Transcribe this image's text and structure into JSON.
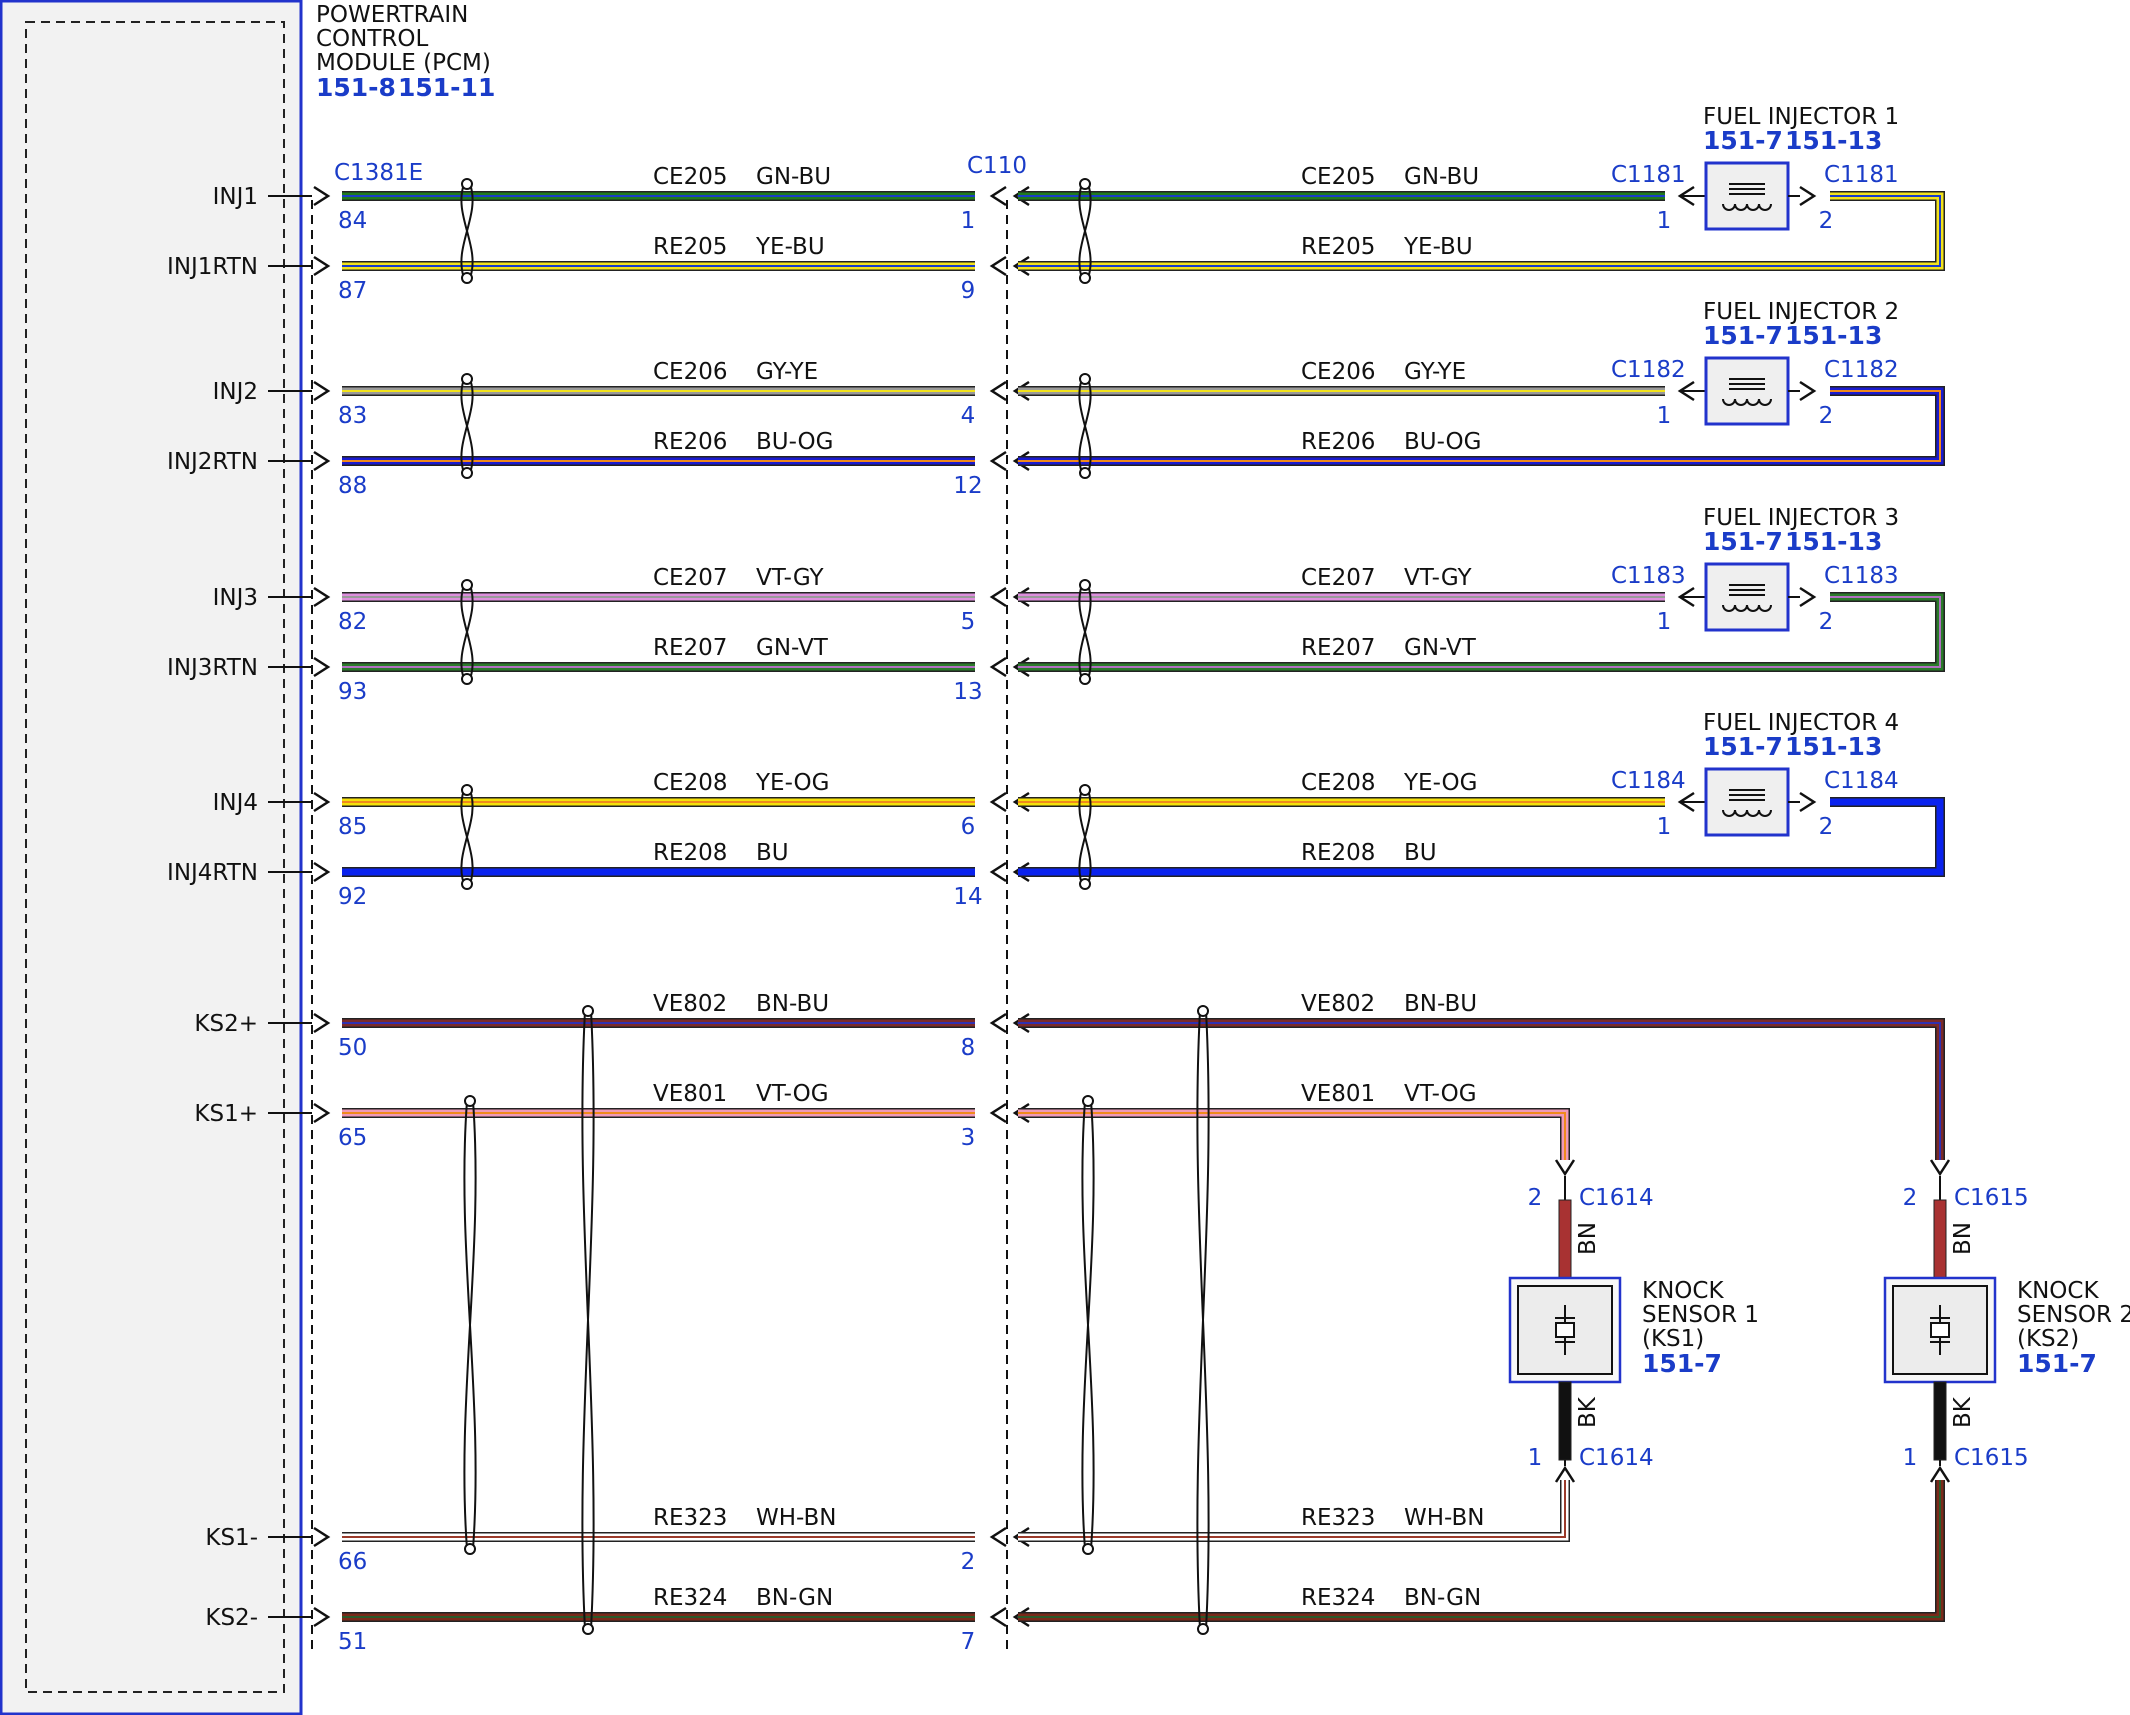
{
  "pcm": {
    "title_lines": [
      "POWERTRAIN",
      "CONTROL",
      "MODULE (PCM)"
    ],
    "refs": [
      "151-8",
      "151-11"
    ],
    "connector": "C1381E"
  },
  "inline_connector": "C110",
  "circuits": [
    {
      "signal": "INJ1",
      "circuit": "CE205",
      "color_code": "GN-BU",
      "pcm_pin": "84",
      "c110_pin": "1",
      "colors": [
        "#1f7a1f",
        "#1a3cc8"
      ]
    },
    {
      "signal": "INJ1RTN",
      "circuit": "RE205",
      "color_code": "YE-BU",
      "pcm_pin": "87",
      "c110_pin": "9",
      "colors": [
        "#f2e21c",
        "#1a3cc8"
      ]
    },
    {
      "signal": "INJ2",
      "circuit": "CE206",
      "color_code": "GY-YE",
      "pcm_pin": "83",
      "c110_pin": "4",
      "colors": [
        "#9a9a9a",
        "#f2e21c"
      ]
    },
    {
      "signal": "INJ2RTN",
      "circuit": "RE206",
      "color_code": "BU-OG",
      "pcm_pin": "88",
      "c110_pin": "12",
      "colors": [
        "#1a1ad0",
        "#f08a1c"
      ]
    },
    {
      "signal": "INJ3",
      "circuit": "CE207",
      "color_code": "VT-GY",
      "pcm_pin": "82",
      "c110_pin": "5",
      "colors": [
        "#dc8fdc",
        "#9a9a9a"
      ]
    },
    {
      "signal": "INJ3RTN",
      "circuit": "RE207",
      "color_code": "GN-VT",
      "pcm_pin": "93",
      "c110_pin": "13",
      "colors": [
        "#2a7a2a",
        "#b070c0"
      ]
    },
    {
      "signal": "INJ4",
      "circuit": "CE208",
      "color_code": "YE-OG",
      "pcm_pin": "85",
      "c110_pin": "6",
      "colors": [
        "#f5e10a",
        "#f08a1c"
      ]
    },
    {
      "signal": "INJ4RTN",
      "circuit": "RE208",
      "color_code": "BU",
      "pcm_pin": "92",
      "c110_pin": "14",
      "colors": [
        "#0a22ee"
      ]
    },
    {
      "signal": "KS2+",
      "circuit": "VE802",
      "color_code": "BN-BU",
      "pcm_pin": "50",
      "c110_pin": "8",
      "colors": [
        "#7a2a2a",
        "#3030b0"
      ]
    },
    {
      "signal": "KS1+",
      "circuit": "VE801",
      "color_code": "VT-OG",
      "pcm_pin": "65",
      "c110_pin": "3",
      "colors": [
        "#f09ab8",
        "#f08a1c"
      ]
    },
    {
      "signal": "KS1-",
      "circuit": "RE323",
      "color_code": "WH-BN",
      "pcm_pin": "66",
      "c110_pin": "2",
      "colors": [
        "#ffffff",
        "#9a3a2a"
      ]
    },
    {
      "signal": "KS2-",
      "circuit": "RE324",
      "color_code": "BN-GN",
      "pcm_pin": "51",
      "c110_pin": "7",
      "colors": [
        "#7a2a1a",
        "#2a5a2a"
      ]
    }
  ],
  "injectors": [
    {
      "name": "FUEL INJECTOR 1",
      "refs": [
        "151-7",
        "151-13"
      ],
      "connector": "C1181",
      "pin_in": "1",
      "pin_out": "2"
    },
    {
      "name": "FUEL INJECTOR 2",
      "refs": [
        "151-7",
        "151-13"
      ],
      "connector": "C1182",
      "pin_in": "1",
      "pin_out": "2"
    },
    {
      "name": "FUEL INJECTOR 3",
      "refs": [
        "151-7",
        "151-13"
      ],
      "connector": "C1183",
      "pin_in": "1",
      "pin_out": "2"
    },
    {
      "name": "FUEL INJECTOR 4",
      "refs": [
        "151-7",
        "151-13"
      ],
      "connector": "C1184",
      "pin_in": "1",
      "pin_out": "2"
    }
  ],
  "knock_sensors": [
    {
      "name_lines": [
        "KNOCK",
        "SENSOR 1",
        "(KS1)"
      ],
      "ref": "151-7",
      "connector": "C1614",
      "pin_top": "2",
      "pin_bottom": "1",
      "wire_top": "BN",
      "wire_bottom": "BK"
    },
    {
      "name_lines": [
        "KNOCK",
        "SENSOR 2",
        "(KS2)"
      ],
      "ref": "151-7",
      "connector": "C1615",
      "pin_top": "2",
      "pin_bottom": "1",
      "wire_top": "BN",
      "wire_bottom": "BK"
    }
  ],
  "colors": {
    "module_border": "#2233cc",
    "text_blue": "#1a3cc8",
    "wire_bn": "#a83232",
    "wire_bk": "#111111"
  }
}
